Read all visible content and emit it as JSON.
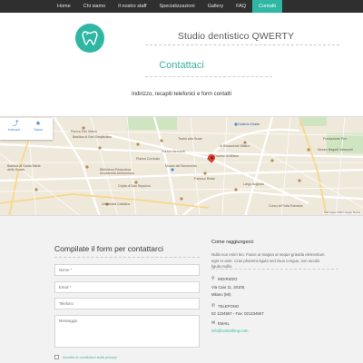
{
  "nav": {
    "items": [
      "Home",
      "Chi siamo",
      "Il nostro staff",
      "Specializzazioni",
      "Gallery",
      "FAQ",
      "Contatti"
    ],
    "active_index": 6
  },
  "header": {
    "logo_icon": "tooth-icon",
    "site_name": "Studio dentistico QWERTY"
  },
  "page": {
    "title": "Contattaci",
    "subtitle": "Indirizzo, recapiti telefonici e form contatti"
  },
  "map": {
    "actions": [
      {
        "label": "Indicazi...",
        "icon": "directions-icon"
      },
      {
        "label": "Salva",
        "icon": "star-icon"
      }
    ],
    "labels": [
      "Piazza San Marco",
      "Basilica di San Simpliciano",
      "Galleria d'Italia",
      "Università Cattolica",
      "Duomo di Milano",
      "Palazzo Reale",
      "Museo del Novecento",
      "Biblioteca Pinacoteca Accademia Ambrosiana",
      "Basilica di Santa Maria delle Grazie",
      "Cripta di San Sepolcro",
      "Piazza Mercanti",
      "la Rinascente Milano",
      "Fondazione Pini",
      "Largo Augusto",
      "Museo Bagatti Valsecchi",
      "Corso di Porta Romana",
      "Piazza Cordusio",
      "Teatro alla Scala"
    ],
    "footer": "Dati mappa ©2017 Google  Termini"
  },
  "form": {
    "title": "Compilate il form per contattarci",
    "name_placeholder": "Nome *",
    "email_placeholder": "Email *",
    "phone_placeholder": "Telefono",
    "message_placeholder": "Messaggio",
    "privacy_label": "Accetto le condizioni sulla privacy"
  },
  "contact": {
    "heading": "Come raggiungerci",
    "text": "Nulla non enim leo. Fusce ut magna ut neque gravida elementum eget et ante. Cras pharetra ligula sed risus congue, non iaculis ligula mollis.",
    "address_label": "INDIRIZZO",
    "address_line1": "Via Caio 11, 20100,",
    "address_line2": "Milano (MI)",
    "phone_label": "TELEFONO",
    "phone_line": "02 1234567 - Fax: 021234567",
    "email_label": "EMAIL",
    "email_line": "info@something.com"
  },
  "colors": {
    "accent": "#2fb7a3",
    "nav_bg": "#2f2f2f",
    "lower_bg": "#f2f2f2"
  }
}
